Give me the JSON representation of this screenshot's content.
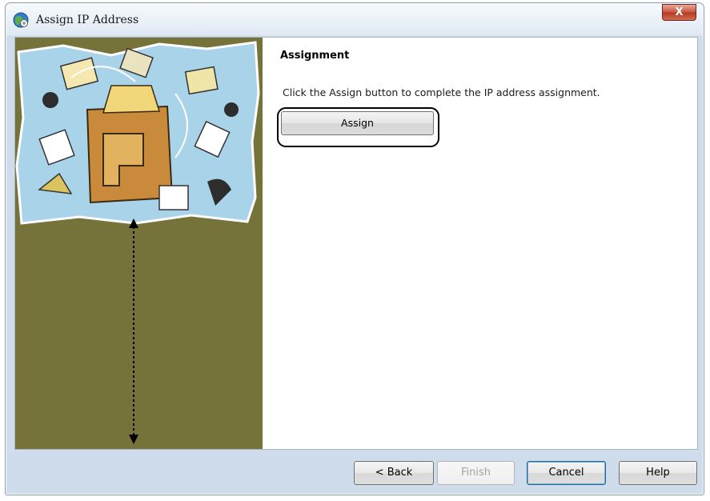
{
  "window": {
    "title": "Assign IP Address",
    "close_label": "X"
  },
  "content": {
    "heading": "Assignment",
    "instructions": "Click the Assign button to complete the IP address assignment.",
    "assign_label": "Assign"
  },
  "footer": {
    "back_label": "< Back",
    "finish_label": "Finish",
    "cancel_label": "Cancel",
    "help_label": "Help"
  },
  "colors": {
    "side_panel": "#75723a",
    "illustration_sky": "#a9d3e8",
    "default_button_border": "#2c628b"
  },
  "icons": {
    "app": "globe-network-icon",
    "close": "close-icon"
  }
}
